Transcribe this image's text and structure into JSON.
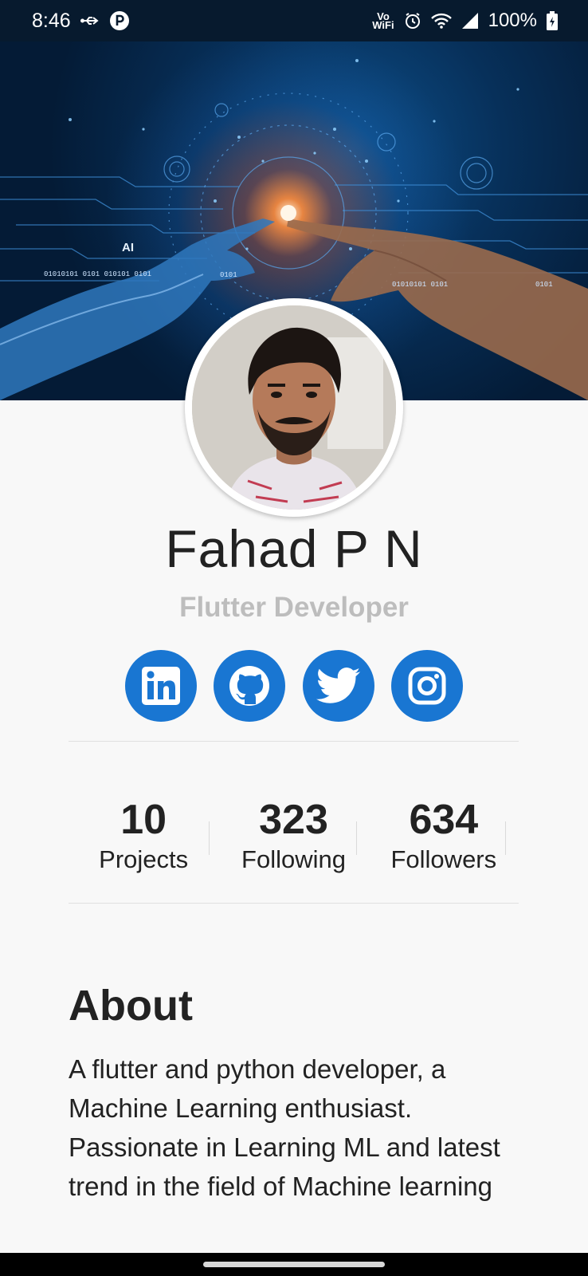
{
  "status_bar": {
    "time": "8:46",
    "vowifi_top": "Vo",
    "vowifi_bottom": "WiFi",
    "battery": "100%",
    "icons": [
      "usb-icon",
      "notification-p-icon",
      "alarm-icon",
      "wifi-icon",
      "cell-signal-icon",
      "battery-charging-icon"
    ]
  },
  "cover": {
    "label_ai": "AI",
    "binary_1": "01010101 0101 010101 0101",
    "binary_2": "0101",
    "binary_3": "01010101 0101",
    "binary_4": "0101"
  },
  "profile": {
    "name": "Fahad P N",
    "role": "Flutter Developer"
  },
  "socials": [
    {
      "name": "LinkedIn",
      "icon": "linkedin-icon"
    },
    {
      "name": "GitHub",
      "icon": "github-icon"
    },
    {
      "name": "Twitter",
      "icon": "twitter-icon"
    },
    {
      "name": "Instagram",
      "icon": "instagram-icon"
    }
  ],
  "stats": [
    {
      "value": "10",
      "label": "Projects"
    },
    {
      "value": "323",
      "label": "Following"
    },
    {
      "value": "634",
      "label": "Followers"
    }
  ],
  "about": {
    "title": "About",
    "text": "A flutter and python developer, a Machine Learning enthusiast. Passionate in Learning ML and latest trend in the field of Machine learning"
  },
  "colors": {
    "accent": "#1976d2",
    "role_text": "#bdbdbd",
    "background": "#f8f8f8"
  }
}
